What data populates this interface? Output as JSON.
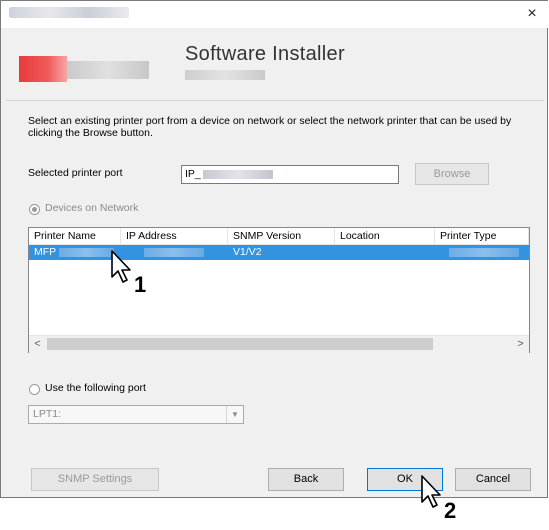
{
  "window": {
    "close_glyph": "×"
  },
  "banner": {
    "title": "Software Installer"
  },
  "instructions": "Select an existing printer port from a device on network or select the network printer that can be used by clicking the Browse button.",
  "port": {
    "label": "Selected printer port",
    "value": "IP_",
    "browse_label": "Browse"
  },
  "devices": {
    "radio_label": "Devices on Network",
    "columns": [
      "Printer Name",
      "IP Address",
      "SNMP Version",
      "Location",
      "Printer Type"
    ],
    "rows": [
      {
        "printer_name": "MFP",
        "snmp_version": "V1/V2"
      }
    ],
    "scroll_left_glyph": "<",
    "scroll_right_glyph": ">"
  },
  "following_port": {
    "radio_label": "Use the following port",
    "selected": "LPT1:"
  },
  "buttons": {
    "snmp_settings": "SNMP Settings",
    "back": "Back",
    "ok": "OK",
    "cancel": "Cancel"
  },
  "annotations": {
    "step1": "1",
    "step2": "2"
  }
}
